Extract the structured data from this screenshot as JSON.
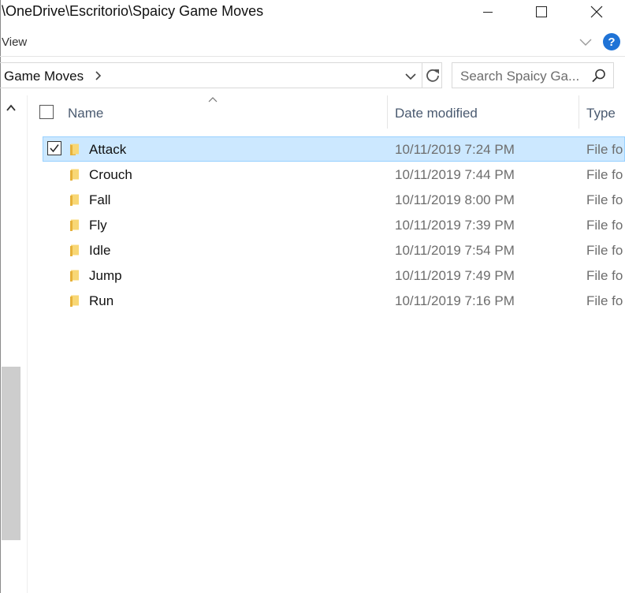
{
  "window": {
    "title": "\\OneDrive\\Escritorio\\Spaicy Game Moves",
    "ribbon_tab": "View",
    "help_glyph": "?"
  },
  "address": {
    "breadcrumb": "Game Moves",
    "search_placeholder": "Search Spaicy Ga..."
  },
  "columns": {
    "name": "Name",
    "date_modified": "Date modified",
    "type": "Type"
  },
  "files": [
    {
      "name": "Attack",
      "date": "10/11/2019 7:24 PM",
      "type": "File fo",
      "selected": true
    },
    {
      "name": "Crouch",
      "date": "10/11/2019 7:44 PM",
      "type": "File fo",
      "selected": false
    },
    {
      "name": "Fall",
      "date": "10/11/2019 8:00 PM",
      "type": "File fo",
      "selected": false
    },
    {
      "name": "Fly",
      "date": "10/11/2019 7:39 PM",
      "type": "File fo",
      "selected": false
    },
    {
      "name": "Idle",
      "date": "10/11/2019 7:54 PM",
      "type": "File fo",
      "selected": false
    },
    {
      "name": "Jump",
      "date": "10/11/2019 7:49 PM",
      "type": "File fo",
      "selected": false
    },
    {
      "name": "Run",
      "date": "10/11/2019 7:16 PM",
      "type": "File fo",
      "selected": false
    }
  ],
  "colors": {
    "selection_bg": "#cce8ff",
    "selection_border": "#99d1ff",
    "folder_yellow": "#f8d775",
    "help_blue": "#1f73d6"
  },
  "icons": {
    "minimize": "minimize-icon",
    "maximize": "maximize-icon",
    "close": "close-icon",
    "ribbon_expand": "chevron-down-icon",
    "help": "help-icon",
    "breadcrumb_separator": "chevron-right-icon",
    "address_dropdown": "chevron-down-icon",
    "refresh": "refresh-icon",
    "search": "search-icon",
    "scroll_up": "chevron-up-icon",
    "sort": "sort-ascending-icon",
    "folder": "folder-icon",
    "checkbox_checked": "checkmark-icon"
  }
}
